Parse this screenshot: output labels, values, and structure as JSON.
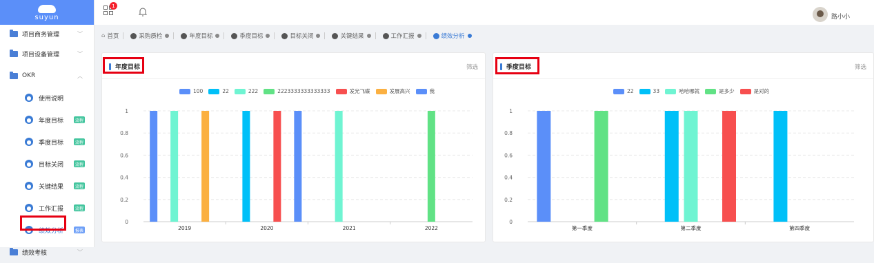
{
  "sidebar": {
    "logo_text": "suyun",
    "items": [
      {
        "label": "项目商务管理",
        "icon": "folder-icon"
      },
      {
        "label": "项目设备管理",
        "icon": "folder-icon"
      },
      {
        "label": "OKR",
        "icon": "folder-icon"
      },
      {
        "label": "使用说明",
        "icon": "person-icon"
      },
      {
        "label": "年度目标",
        "icon": "person-icon",
        "tag": "流程"
      },
      {
        "label": "季度目标",
        "icon": "person-icon",
        "tag": "流程"
      },
      {
        "label": "目标关闭",
        "icon": "person-icon",
        "tag": "流程"
      },
      {
        "label": "关键结果",
        "icon": "person-icon",
        "tag": "流程"
      },
      {
        "label": "工作汇报",
        "icon": "person-icon",
        "tag": "流程"
      },
      {
        "label": "绩效分析",
        "icon": "person-icon",
        "tag": "报表"
      },
      {
        "label": "绩效考核",
        "icon": "folder-icon"
      }
    ]
  },
  "topbar": {
    "notification_count": "1",
    "username": "路小小"
  },
  "tabs": [
    {
      "label": "首页"
    },
    {
      "label": "采购质检"
    },
    {
      "label": "年度目标"
    },
    {
      "label": "季度目标"
    },
    {
      "label": "目标关闭"
    },
    {
      "label": "关键结果"
    },
    {
      "label": "工作汇报"
    },
    {
      "label": "绩效分析"
    }
  ],
  "panels": {
    "annual": {
      "title": "年度目标",
      "filter": "筛选"
    },
    "quarterly": {
      "title": "季度目标",
      "filter": "筛选"
    }
  },
  "colors": {
    "accent": "#3a7bd5",
    "highlight_box": "#e60012"
  },
  "chart_data": [
    {
      "type": "bar",
      "title": "年度目标",
      "categories": [
        "2019",
        "2020",
        "2021",
        "2022"
      ],
      "ylim": [
        0,
        1
      ],
      "yticks": [
        "0",
        "0.2",
        "0.4",
        "0.6",
        "0.8",
        "1"
      ],
      "grid": true,
      "legend_position": "top",
      "series": [
        {
          "name": "100",
          "color": "#5b8ff9",
          "values": [
            1,
            0,
            0,
            0
          ]
        },
        {
          "name": "22",
          "color": "#00c0f8",
          "values": [
            0,
            1,
            0,
            0
          ]
        },
        {
          "name": "222",
          "color": "#6ff4d2",
          "values": [
            1,
            0,
            1,
            0
          ]
        },
        {
          "name": "2223333333333333",
          "color": "#61e285",
          "values": [
            0,
            0,
            0,
            1
          ]
        },
        {
          "name": "发光飞碟",
          "color": "#f74f4f",
          "values": [
            0,
            1,
            0,
            0
          ]
        },
        {
          "name": "发展高兴",
          "color": "#fbb041",
          "values": [
            1,
            0,
            0,
            0
          ]
        },
        {
          "name": "我",
          "color": "#5b8ff9",
          "values": [
            0,
            1,
            0,
            0
          ]
        }
      ]
    },
    {
      "type": "bar",
      "title": "季度目标",
      "categories": [
        "第一季度",
        "第二季度",
        "第四季度"
      ],
      "ylim": [
        0,
        1
      ],
      "yticks": [
        "0",
        "0.2",
        "0.4",
        "0.6",
        "0.8",
        "1"
      ],
      "grid": true,
      "legend_position": "top",
      "series": [
        {
          "name": "22",
          "color": "#5b8ff9",
          "values": [
            1,
            0,
            0
          ]
        },
        {
          "name": "33",
          "color": "#00c0f8",
          "values": [
            0,
            1,
            1
          ]
        },
        {
          "name": "哈哈哪就",
          "color": "#6ff4d2",
          "values": [
            0,
            1,
            0
          ]
        },
        {
          "name": "是多少",
          "color": "#61e285",
          "values": [
            1,
            0,
            0
          ]
        },
        {
          "name": "是对的",
          "color": "#f74f4f",
          "values": [
            0,
            1,
            0
          ]
        }
      ]
    }
  ]
}
